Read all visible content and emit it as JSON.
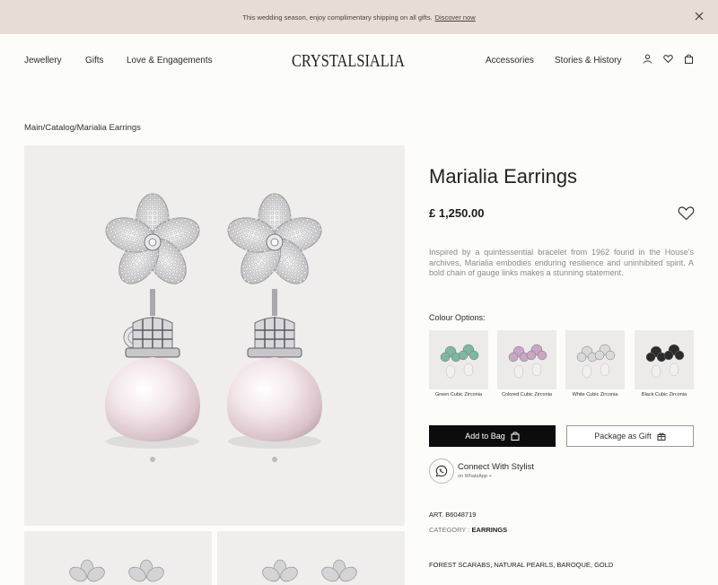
{
  "announcement": {
    "text": "This wedding season, enjoy complimentary shipping on all gifts.",
    "link": "Discover now"
  },
  "nav": {
    "left": [
      "Jewellery",
      "Gifts",
      "Love & Engagements"
    ],
    "brand": "CRYSTALSIALIA",
    "right": [
      "Accessories",
      "Stories & History"
    ]
  },
  "breadcrumb": "Main/Catalog/Marialia Earrings",
  "product": {
    "title": "Marialia Earrings",
    "price": "£ 1,250.00",
    "description": "Inspired by a quintessential bracelet from 1962 found in the House's archives, Marialia embodies enduring resilience and uninhibited spirit. A bold chain of gauge links makes a stunning statement.",
    "colour_label": "Colour Options:",
    "colour_options": [
      {
        "name": "Green Cubic Zirconia",
        "color": "#7fb7a0"
      },
      {
        "name": "Colored Cubic Zirconia",
        "color": "#c9a6c4"
      },
      {
        "name": "White Cubic Zirconia",
        "color": "#d9d9d9"
      },
      {
        "name": "Black Cubic Zirconia",
        "color": "#2b2b2b"
      }
    ],
    "add_to_bag": "Add to Bag",
    "package_gift": "Package as Gift",
    "stylist_title": "Connect With Stylist",
    "stylist_sub": "on WhatsApp +",
    "art_label": "ART.",
    "art": "B6048719",
    "category_label": "CATEGORY :",
    "category": "EARRINGS",
    "tags": "FOREST SCARABS, NATURAL PEARLS, BAROQUE, GOLD"
  }
}
